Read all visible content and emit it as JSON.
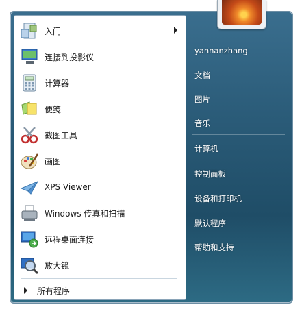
{
  "left_items": [
    {
      "label": "入门",
      "icon": "getting-started-icon",
      "has_submenu": true
    },
    {
      "label": "连接到投影仪",
      "icon": "projector-icon",
      "has_submenu": false
    },
    {
      "label": "计算器",
      "icon": "calculator-icon",
      "has_submenu": false
    },
    {
      "label": "便笺",
      "icon": "sticky-notes-icon",
      "has_submenu": false
    },
    {
      "label": "截图工具",
      "icon": "snipping-tool-icon",
      "has_submenu": false
    },
    {
      "label": "画图",
      "icon": "paint-icon",
      "has_submenu": false
    },
    {
      "label": "XPS Viewer",
      "icon": "xps-viewer-icon",
      "has_submenu": false
    },
    {
      "label": "Windows 传真和扫描",
      "icon": "fax-scan-icon",
      "has_submenu": false
    },
    {
      "label": "远程桌面连接",
      "icon": "remote-desktop-icon",
      "has_submenu": false
    },
    {
      "label": "放大镜",
      "icon": "magnifier-icon",
      "has_submenu": false
    }
  ],
  "all_programs": "所有程序",
  "right_items": [
    {
      "label": "yannanzhang"
    },
    {
      "label": "文档"
    },
    {
      "label": "图片"
    },
    {
      "label": "音乐"
    },
    {
      "label": "计算机"
    },
    {
      "label": "控制面板"
    },
    {
      "label": "设备和打印机"
    },
    {
      "label": "默认程序"
    },
    {
      "label": "帮助和支持"
    }
  ]
}
